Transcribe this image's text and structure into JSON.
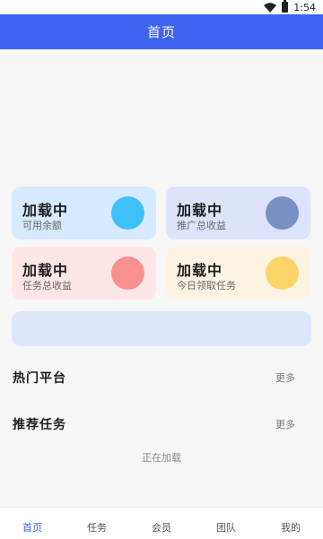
{
  "status_bar": {
    "time": "1:54"
  },
  "header": {
    "title": "首页"
  },
  "stats": [
    {
      "value": "加载中",
      "label": "可用余额",
      "card_color": "#d6ebff",
      "circle_color": "#3ec1fb"
    },
    {
      "value": "加载中",
      "label": "推广总收益",
      "card_color": "#dce3fb",
      "circle_color": "#7a8fc2"
    },
    {
      "value": "加载中",
      "label": "任务总收益",
      "card_color": "#ffe6e6",
      "circle_color": "#f89090"
    },
    {
      "value": "加载中",
      "label": "今日领取任务",
      "card_color": "#fdf3e3",
      "circle_color": "#fdd46a"
    }
  ],
  "sections": [
    {
      "title": "热门平台",
      "more": "更多"
    },
    {
      "title": "推荐任务",
      "more": "更多"
    }
  ],
  "loading_text": "正在加载",
  "tabs": [
    {
      "label": "首页",
      "active": true
    },
    {
      "label": "任务",
      "active": false
    },
    {
      "label": "会员",
      "active": false
    },
    {
      "label": "团队",
      "active": false
    },
    {
      "label": "我的",
      "active": false
    }
  ],
  "colors": {
    "primary": "#3f63f1",
    "banner": "#dde6fd"
  }
}
